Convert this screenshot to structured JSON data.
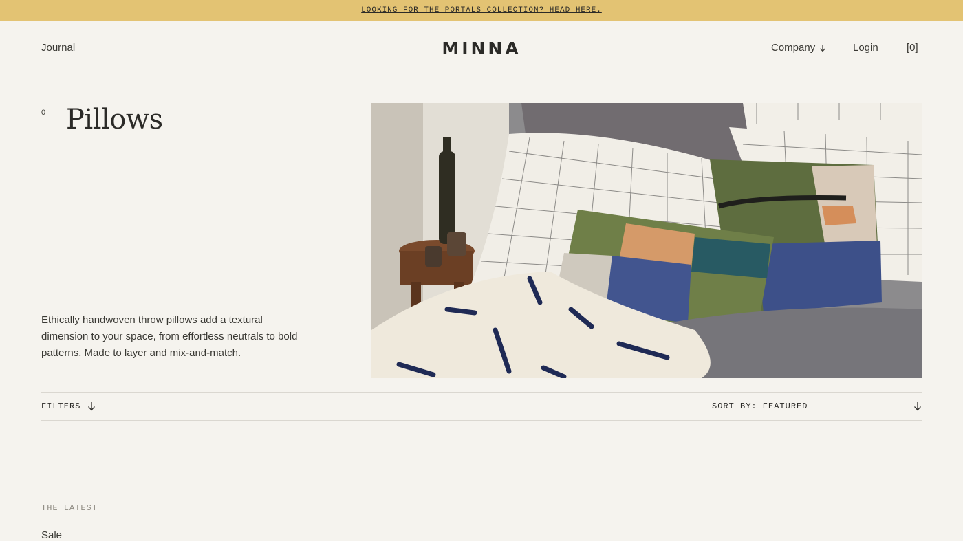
{
  "announcement": {
    "text": "LOOKING FOR THE PORTALS COLLECTION? HEAD HERE."
  },
  "header": {
    "journal": "Journal",
    "logo": "MINNA",
    "company": "Company",
    "login": "Login",
    "cart": "[0]"
  },
  "collection": {
    "count": "0",
    "title": "Pillows",
    "description": "Ethically handwoven throw pillows add a textural dimension to your space, from effortless neutrals to bold patterns. Made to layer and mix-and-match."
  },
  "hero": {
    "icon": "hero-image"
  },
  "toolbar": {
    "filters_label": "FILTERS",
    "sort_label": "SORT BY: FEATURED"
  },
  "footer_nav": {
    "heading": "THE LATEST",
    "items": [
      "Sale"
    ]
  },
  "colors": {
    "background": "#f5f3ee",
    "announcement_bar": "#e3c373",
    "text": "#2b2a27"
  }
}
